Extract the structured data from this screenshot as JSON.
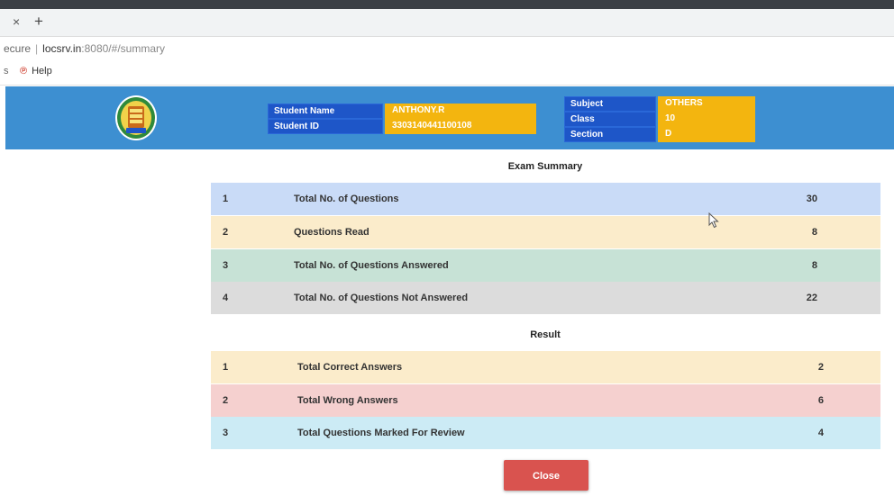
{
  "browser": {
    "tab_close_glyph": "×",
    "tab_new_glyph": "+",
    "address": {
      "security_text": "ecure",
      "host": "locsrv.in",
      "path": ":8080/#/summary"
    },
    "bookmarks": {
      "partial_glyph": "s",
      "help_label": "Help"
    }
  },
  "header": {
    "student_name_label": "Student Name",
    "student_name_value": "ANTHONY.R",
    "student_id_label": "Student ID",
    "student_id_value": "3303140441100108",
    "subject_label": "Subject",
    "subject_value": "OTHERS",
    "class_label": "Class",
    "class_value": "10",
    "section_label": "Section",
    "section_value": "D"
  },
  "summary": {
    "title": "Exam Summary",
    "rows": [
      {
        "num": "1",
        "label": "Total No. of Questions",
        "value": "30",
        "color": "#c9dbf7"
      },
      {
        "num": "2",
        "label": "Questions Read",
        "value": "8",
        "color": "#fbeccb"
      },
      {
        "num": "3",
        "label": "Total No. of Questions Answered",
        "value": "8",
        "color": "#c7e2d6"
      },
      {
        "num": "4",
        "label": "Total No. of Questions Not Answered",
        "value": "22",
        "color": "#dcdcdc"
      }
    ]
  },
  "result": {
    "title": "Result",
    "rows": [
      {
        "num": "1",
        "label": "Total Correct Answers",
        "value": "2",
        "color": "#fbeccb"
      },
      {
        "num": "2",
        "label": "Total Wrong Answers",
        "value": "6",
        "color": "#f5d0cf"
      },
      {
        "num": "3",
        "label": "Total Questions Marked For Review",
        "value": "4",
        "color": "#ccebf5"
      }
    ]
  },
  "close_button_label": "Close",
  "colors": {
    "header_bg": "#3d8fd1",
    "label_bg": "#1e56c8",
    "value_bg": "#f3b50f",
    "close_bg": "#d9534f"
  },
  "icons": {
    "emblem": "tamil-nadu-emblem-icon",
    "help": "help-icon",
    "cursor": "mouse-pointer-icon"
  }
}
